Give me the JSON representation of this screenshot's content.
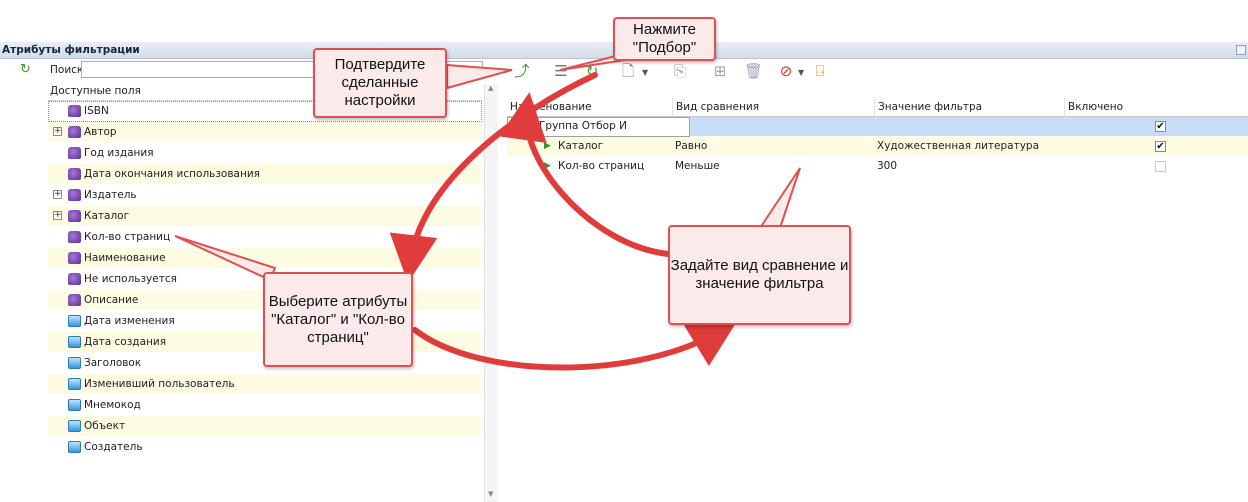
{
  "panel": {
    "title": "Атрибуты фильтрации"
  },
  "search": {
    "label": "Поиск",
    "value": ""
  },
  "tree": {
    "header": "Доступные поля",
    "items": [
      {
        "label": "ISBN",
        "icon": "purple-attribute-icon",
        "expandable": false
      },
      {
        "label": "Автор",
        "icon": "purple-attribute-icon",
        "expandable": true
      },
      {
        "label": "Год издания",
        "icon": "purple-attribute-icon",
        "expandable": false
      },
      {
        "label": "Дата окончания использования",
        "icon": "purple-attribute-icon",
        "expandable": false
      },
      {
        "label": "Издатель",
        "icon": "purple-attribute-icon",
        "expandable": true
      },
      {
        "label": "Каталог",
        "icon": "purple-attribute-icon",
        "expandable": true
      },
      {
        "label": "Кол-во страниц",
        "icon": "purple-attribute-icon",
        "expandable": false
      },
      {
        "label": "Наименование",
        "icon": "purple-attribute-icon",
        "expandable": false
      },
      {
        "label": "Не используется",
        "icon": "purple-attribute-icon",
        "expandable": false
      },
      {
        "label": "Описание",
        "icon": "purple-attribute-icon",
        "expandable": false
      },
      {
        "label": "Дата изменения",
        "icon": "blue-system-icon",
        "expandable": false
      },
      {
        "label": "Дата создания",
        "icon": "blue-system-icon",
        "expandable": false
      },
      {
        "label": "Заголовок",
        "icon": "blue-system-icon",
        "expandable": false
      },
      {
        "label": "Изменивший пользователь",
        "icon": "blue-system-icon",
        "expandable": false
      },
      {
        "label": "Мнемокод",
        "icon": "blue-system-icon",
        "expandable": false
      },
      {
        "label": "Объект",
        "icon": "blue-system-icon",
        "expandable": false
      },
      {
        "label": "Создатель",
        "icon": "blue-system-icon",
        "expandable": false
      }
    ]
  },
  "grid": {
    "columns": [
      "Наименование",
      "Вид сравнения",
      "Значение фильтра",
      "Включено"
    ],
    "rows": [
      {
        "name": "Группа Отбор И",
        "compare": "",
        "value": "",
        "enabled": true
      },
      {
        "name": "Каталог",
        "compare": "Равно",
        "value": "Художественная литература",
        "enabled": true
      },
      {
        "name": "Кол-во страниц",
        "compare": "Меньше",
        "value": "300",
        "enabled": false
      }
    ]
  },
  "callouts": {
    "confirm": "Подтвердите сделанные настройки",
    "pick": "Нажмите \"Подбор\"",
    "select": "Выберите атрибуты \"Каталог\" и \"Кол-во страниц\"",
    "set": "Задайте вид сравнение и значение фильтра"
  },
  "colors": {
    "accent_red": "#e03c3c",
    "row_yellow": "#fdfce2",
    "row_blue": "#c7dcf6"
  }
}
